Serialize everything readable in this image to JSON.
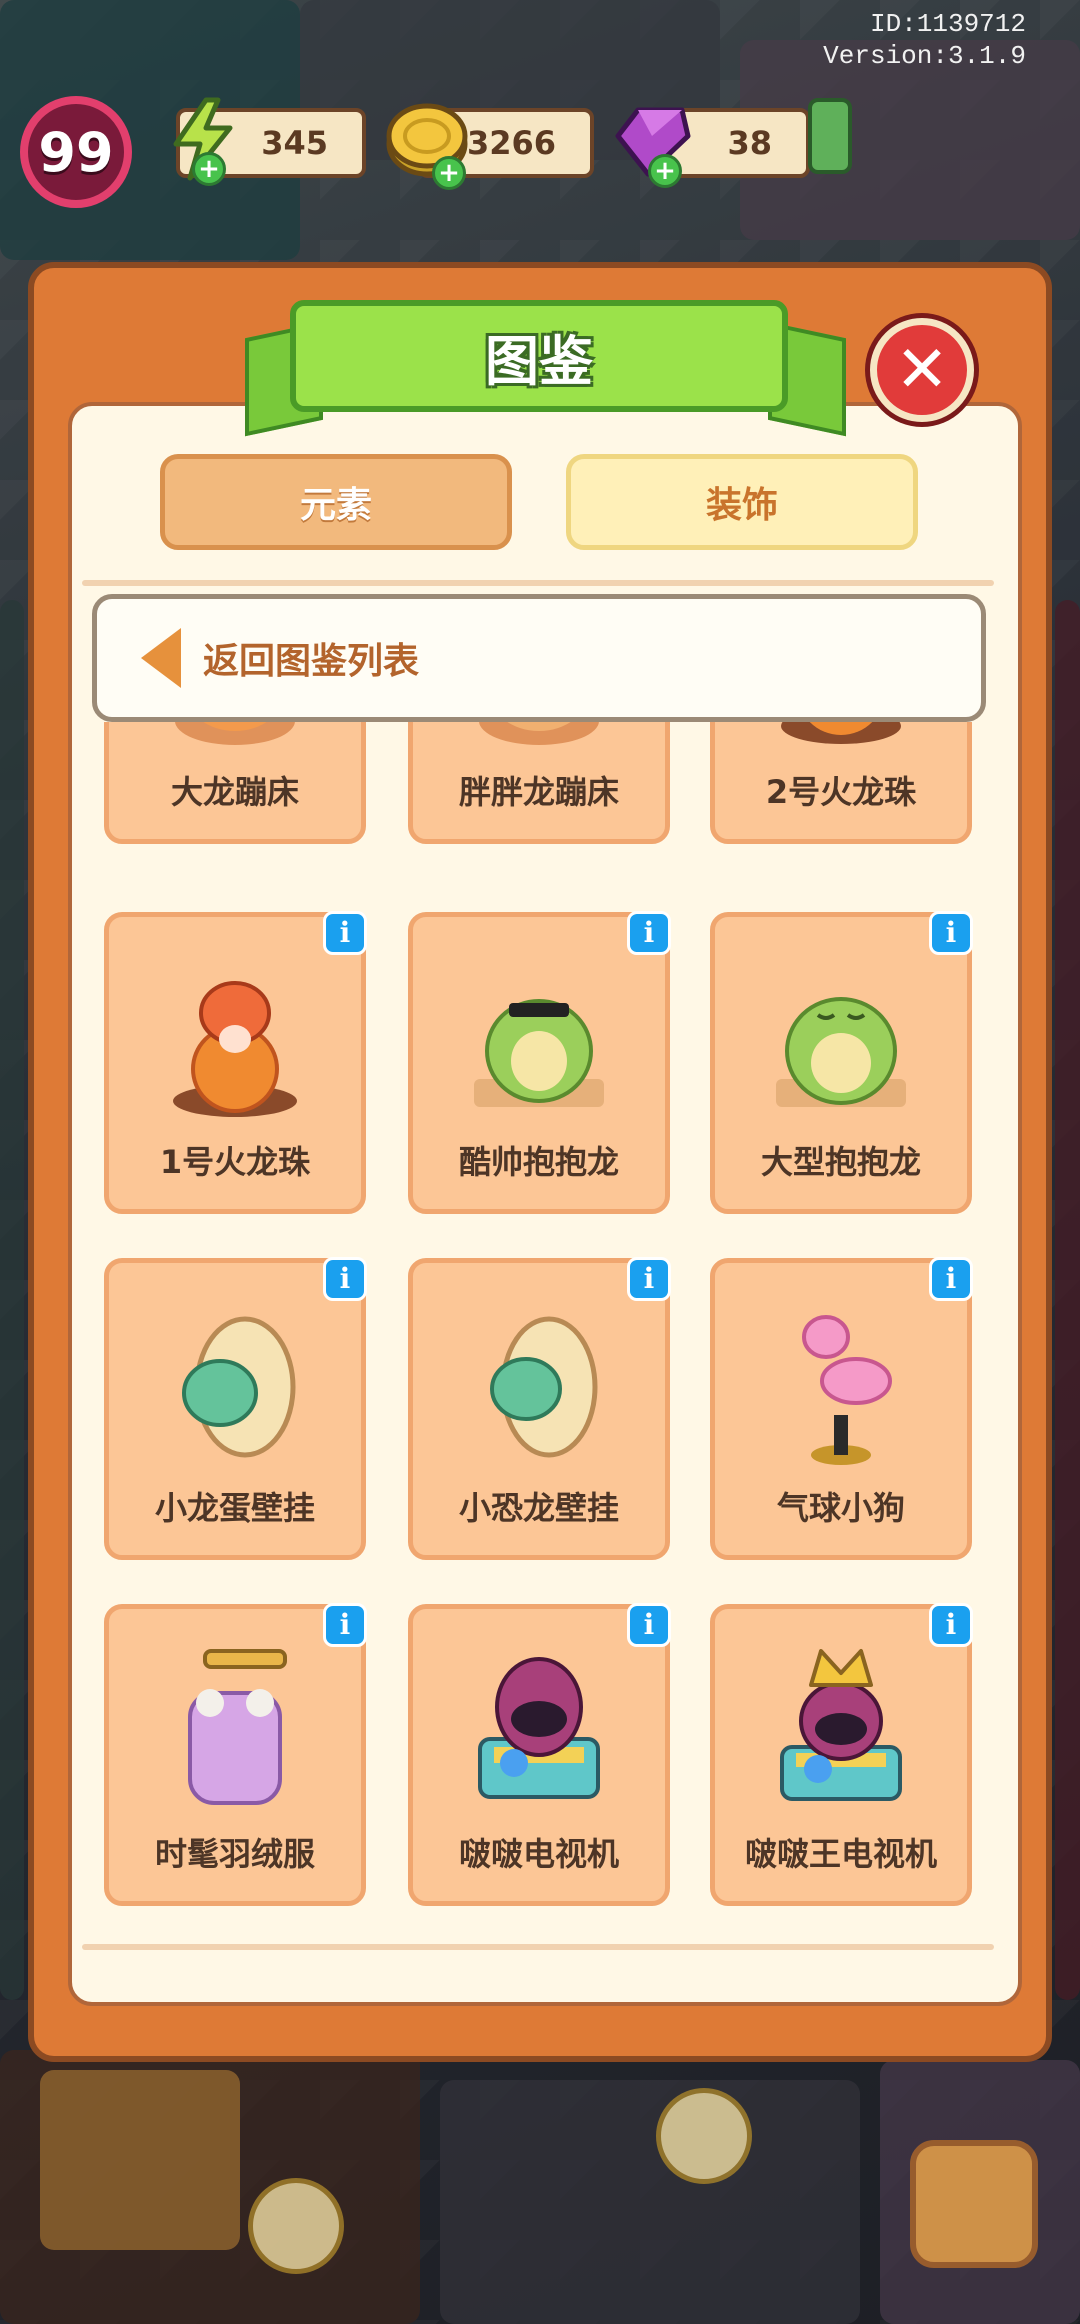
{
  "hud": {
    "id_text": "ID:1139712",
    "version_text": "Version:3.1.9",
    "level": "99",
    "energy": "345",
    "coins": "53266",
    "gems": "38"
  },
  "panel": {
    "title": "图鉴",
    "tabs": [
      {
        "label": "元素"
      },
      {
        "label": "装饰"
      }
    ],
    "back_label": "返回图鉴列表",
    "items": [
      {
        "name": "大龙蹦床"
      },
      {
        "name": "胖胖龙蹦床"
      },
      {
        "name": "2号火龙珠"
      },
      {
        "name": "1号火龙珠",
        "info": "i"
      },
      {
        "name": "酷帅抱抱龙",
        "info": "i"
      },
      {
        "name": "大型抱抱龙",
        "info": "i"
      },
      {
        "name": "小龙蛋壁挂",
        "info": "i"
      },
      {
        "name": "小恐龙壁挂",
        "info": "i"
      },
      {
        "name": "气球小狗",
        "info": "i"
      },
      {
        "name": "时髦羽绒服",
        "info": "i"
      },
      {
        "name": "啵啵电视机",
        "info": "i"
      },
      {
        "name": "啵啵王电视机",
        "info": "i"
      }
    ]
  },
  "colors": {
    "panel_orange": "#de7a36",
    "card_peach": "#fcc696",
    "ribbon_green": "#9be24a",
    "close_red": "#e13b3a",
    "info_blue": "#1aa0ef"
  },
  "icons": {
    "energy": "lightning-icon",
    "coins": "coin-icon",
    "gems": "gem-icon",
    "close": "close-icon",
    "back": "back-arrow-icon",
    "info": "info-icon"
  }
}
